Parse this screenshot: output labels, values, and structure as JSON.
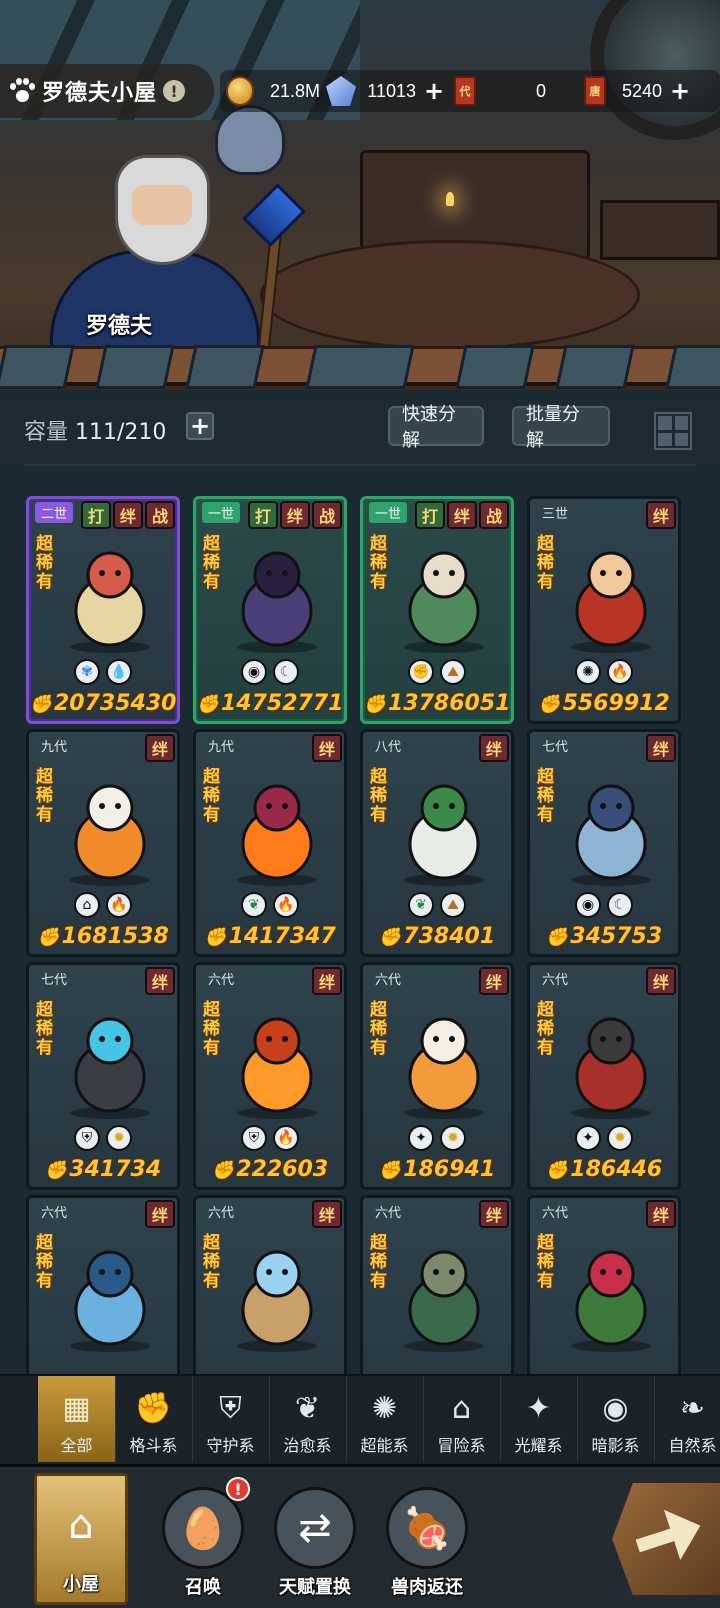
{
  "header": {
    "home_title": "罗德夫小屋",
    "info_symbol": "!",
    "npc_name": "罗德夫"
  },
  "resources": [
    {
      "icon": "gold-coin-icon",
      "value": "21.8M",
      "has_plus": false
    },
    {
      "icon": "crystal-icon",
      "value": "11013",
      "has_plus": true
    },
    {
      "icon": "summon-card-icon",
      "card_text": "代",
      "value": "0",
      "has_plus": false
    },
    {
      "icon": "ticket-card-icon",
      "card_text": "唐",
      "value": "5240",
      "has_plus": true
    }
  ],
  "capacity": {
    "label": "容量",
    "value": "111/210",
    "plus": "+"
  },
  "actions": {
    "quick_decompose": "快速分解",
    "batch_decompose": "批量分解"
  },
  "pets": [
    {
      "generation": "二世",
      "frame": "purple",
      "tags": [
        "打",
        "绊",
        "战"
      ],
      "rarity": "超稀有",
      "elements": [
        "leaf-light",
        "water"
      ],
      "power": "20735430",
      "art": "lotus-maiden"
    },
    {
      "generation": "一世",
      "frame": "green",
      "tags": [
        "打",
        "绊",
        "战"
      ],
      "rarity": "超稀有",
      "elements": [
        "eye",
        "moon"
      ],
      "power": "14752771",
      "art": "nine-tail-fox"
    },
    {
      "generation": "一世",
      "frame": "green",
      "tags": [
        "打",
        "绊",
        "战"
      ],
      "rarity": "超稀有",
      "elements": [
        "fist",
        "earth"
      ],
      "power": "13786051",
      "art": "mushroom-wizard"
    },
    {
      "generation": "三世",
      "frame": "normal",
      "tags": [
        "绊"
      ],
      "rarity": "超稀有",
      "elements": [
        "psychic",
        "fire"
      ],
      "power": "5569912",
      "art": "nezha"
    },
    {
      "generation": "九代",
      "frame": "normal",
      "tags": [
        "绊"
      ],
      "rarity": "超稀有",
      "elements": [
        "shrine",
        "fire"
      ],
      "power": "1681538",
      "art": "cat-swordsman"
    },
    {
      "generation": "九代",
      "frame": "normal",
      "tags": [
        "绊"
      ],
      "rarity": "超稀有",
      "elements": [
        "sprout",
        "fire"
      ],
      "power": "1417347",
      "art": "fire-butterfly"
    },
    {
      "generation": "八代",
      "frame": "normal",
      "tags": [
        "绊"
      ],
      "rarity": "超稀有",
      "elements": [
        "sprout",
        "earth"
      ],
      "power": "738401",
      "art": "white-owl-sage"
    },
    {
      "generation": "七代",
      "frame": "normal",
      "tags": [
        "绊"
      ],
      "rarity": "超稀有",
      "elements": [
        "eye",
        "moon"
      ],
      "power": "345753",
      "art": "ice-qilin"
    },
    {
      "generation": "七代",
      "frame": "normal",
      "tags": [
        "绊"
      ],
      "rarity": "超稀有",
      "elements": [
        "shield",
        "light"
      ],
      "power": "341734",
      "art": "stone-whale"
    },
    {
      "generation": "六代",
      "frame": "normal",
      "tags": [
        "绊"
      ],
      "rarity": "超稀有",
      "elements": [
        "shield",
        "fire"
      ],
      "power": "222603",
      "art": "flame-spirit"
    },
    {
      "generation": "六代",
      "frame": "normal",
      "tags": [
        "绊"
      ],
      "rarity": "超稀有",
      "elements": [
        "star",
        "light"
      ],
      "power": "186941",
      "art": "jelly-granny"
    },
    {
      "generation": "六代",
      "frame": "normal",
      "tags": [
        "绊"
      ],
      "rarity": "超稀有",
      "elements": [
        "star",
        "light"
      ],
      "power": "186446",
      "art": "armored-dragon"
    },
    {
      "generation": "六代",
      "frame": "normal",
      "tags": [
        "绊"
      ],
      "rarity": "超稀有",
      "elements": [],
      "power": "",
      "art": "ice-golem"
    },
    {
      "generation": "六代",
      "frame": "normal",
      "tags": [
        "绊"
      ],
      "rarity": "超稀有",
      "elements": [],
      "power": "",
      "art": "clockwork-orb"
    },
    {
      "generation": "六代",
      "frame": "normal",
      "tags": [
        "绊"
      ],
      "rarity": "超稀有",
      "elements": [],
      "power": "",
      "art": "forest-dryad"
    },
    {
      "generation": "六代",
      "frame": "normal",
      "tags": [
        "绊"
      ],
      "rarity": "超稀有",
      "elements": [],
      "power": "",
      "art": "flower-turtle"
    }
  ],
  "categories": [
    {
      "label": "全部",
      "icon": "blocks-icon",
      "active": true
    },
    {
      "label": "格斗系",
      "icon": "fist-icon",
      "active": false
    },
    {
      "label": "守护系",
      "icon": "shield-icon",
      "active": false
    },
    {
      "label": "治愈系",
      "icon": "sprout-icon",
      "active": false
    },
    {
      "label": "超能系",
      "icon": "psychic-icon",
      "active": false
    },
    {
      "label": "冒险系",
      "icon": "shrine-icon",
      "active": false
    },
    {
      "label": "光耀系",
      "icon": "star-icon",
      "active": false
    },
    {
      "label": "暗影系",
      "icon": "eye-icon",
      "active": false
    },
    {
      "label": "自然系",
      "icon": "leaf-icon",
      "active": false
    }
  ],
  "nav": [
    {
      "label": "小屋",
      "icon": "hut-icon",
      "active": true,
      "alert": false
    },
    {
      "label": "召唤",
      "icon": "egg-icon",
      "active": false,
      "alert": true
    },
    {
      "label": "天赋置换",
      "icon": "swap-arrows-icon",
      "active": false,
      "alert": false
    },
    {
      "label": "兽肉返还",
      "icon": "meat-icon",
      "active": false,
      "alert": false
    }
  ],
  "colors": {
    "power_text": "#ffc431",
    "rarity_text": "#ffcc44",
    "frame_purple": "#7d4fd8",
    "frame_green": "#2ea36b",
    "tab_active": "#c89b3a"
  }
}
